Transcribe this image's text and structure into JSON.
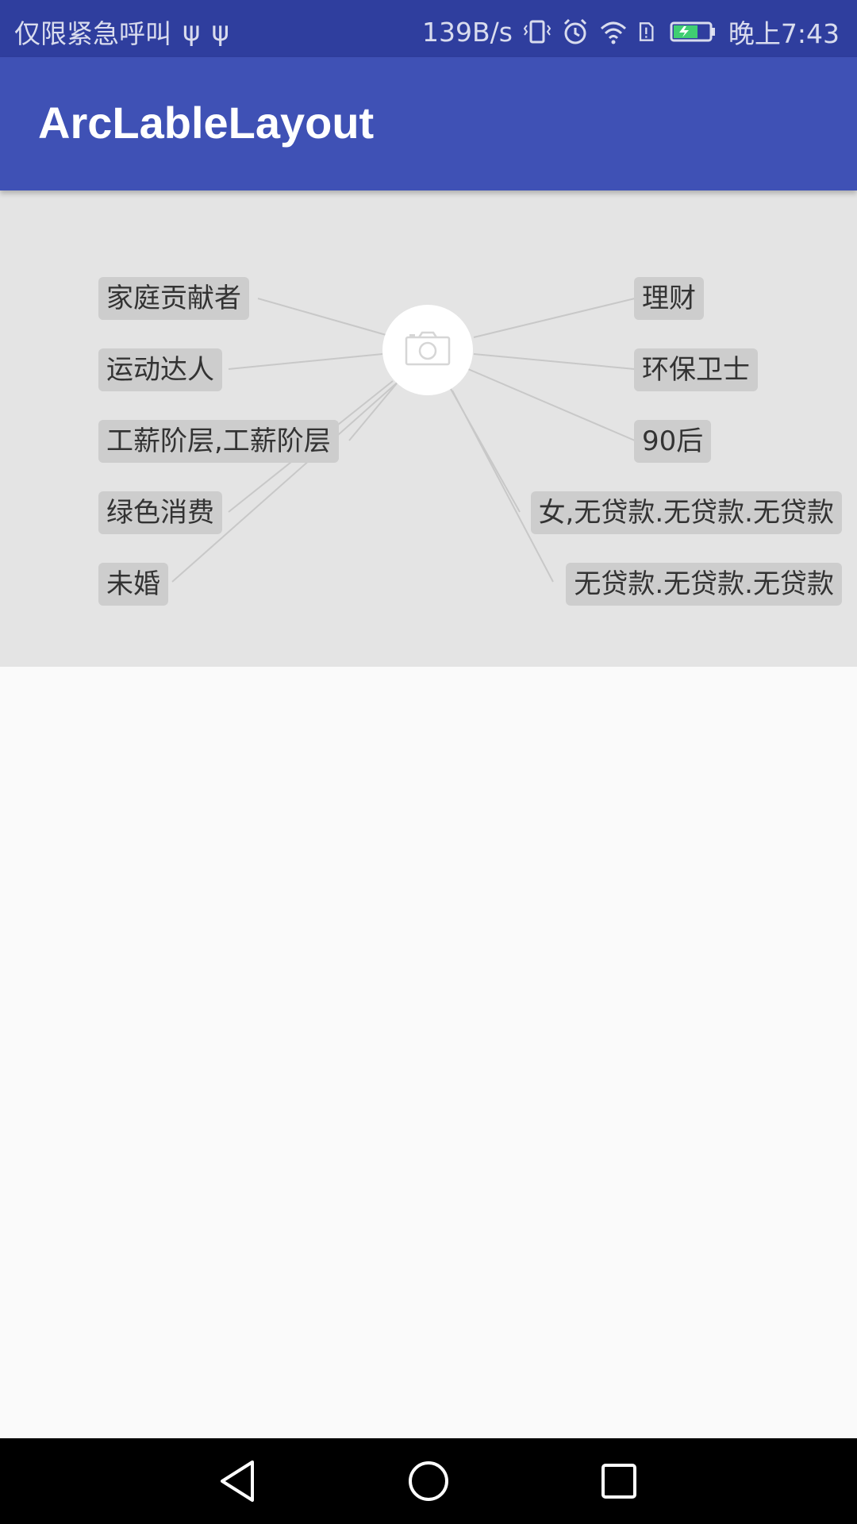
{
  "status_bar": {
    "carrier_text": "仅限紧急呼叫",
    "usb_icon_1": "usb-icon",
    "usb_icon_2": "usb-icon",
    "net_speed": "139B/s",
    "time": "晚上7:43"
  },
  "app_bar": {
    "title": "ArcLableLayout"
  },
  "arc_layout": {
    "center": {
      "icon": "camera-icon"
    },
    "left_tags": [
      "家庭贡献者",
      "运动达人",
      "工薪阶层,工薪阶层",
      "绿色消费",
      "未婚"
    ],
    "right_tags": [
      "理财",
      "环保卫士",
      "90后",
      "女,无贷款.无贷款.无贷款",
      "无贷款.无贷款.无贷款"
    ]
  },
  "nav_bar": {
    "back": "back-icon",
    "home": "home-icon",
    "recents": "recents-icon"
  },
  "colors": {
    "status_bar": "#2f3e9e",
    "app_bar": "#3f51b5",
    "panel": "#e4e4e4",
    "tag": "#cdcdcd"
  }
}
